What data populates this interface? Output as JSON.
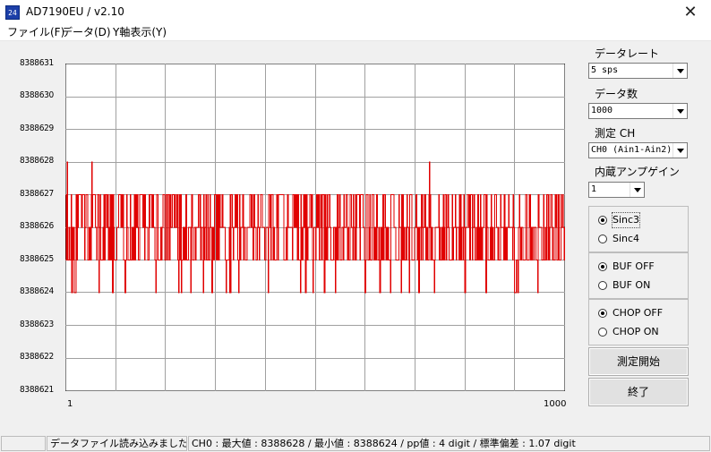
{
  "window": {
    "icon_text": "24",
    "title": "AD7190EU / v2.10",
    "close_glyph": "✕"
  },
  "menu": [
    {
      "label": "ファイル(F)"
    },
    {
      "label": "データ(D)"
    },
    {
      "label": "Y軸表示(Y)"
    }
  ],
  "controls": {
    "data_rate": {
      "label": "データレート",
      "value": "5 sps"
    },
    "data_count": {
      "label": "データ数",
      "value": "1000"
    },
    "channel": {
      "label": "測定 CH",
      "value": "CH0 (Ain1-Ain2)"
    },
    "gain": {
      "label": "内蔵アンプゲイン",
      "value": "1"
    },
    "filter": {
      "options": [
        "Sinc3",
        "Sinc4"
      ],
      "selected": "Sinc3"
    },
    "buffer": {
      "options": [
        "BUF OFF",
        "BUF ON"
      ],
      "selected": "BUF OFF"
    },
    "chop": {
      "options": [
        "CHOP OFF",
        "CHOP ON"
      ],
      "selected": "CHOP OFF"
    },
    "start_button": "測定開始",
    "exit_button": "終了"
  },
  "status": {
    "pane1": "",
    "pane2": "データファイル読み込みました",
    "pane3": "CH0 : 最大値 : 8388628 / 最小値 : 8388624 / pp値 : 4 digit / 標準偏差 : 1.07 digit"
  },
  "chart_data": {
    "type": "line",
    "xlim": [
      1,
      1000
    ],
    "ylim": [
      8388621,
      8388631
    ],
    "x_tick_labels": [
      "1",
      "1000"
    ],
    "y_tick_labels": [
      "8388631",
      "8388630",
      "8388629",
      "8388628",
      "8388627",
      "8388626",
      "8388625",
      "8388624",
      "8388623",
      "8388622",
      "8388621"
    ],
    "grid": true,
    "line_color": "#e00000",
    "series": [
      {
        "stats": {
          "max": 8388628,
          "min": 8388624,
          "pp": 4,
          "std": 1.07
        }
      }
    ]
  }
}
